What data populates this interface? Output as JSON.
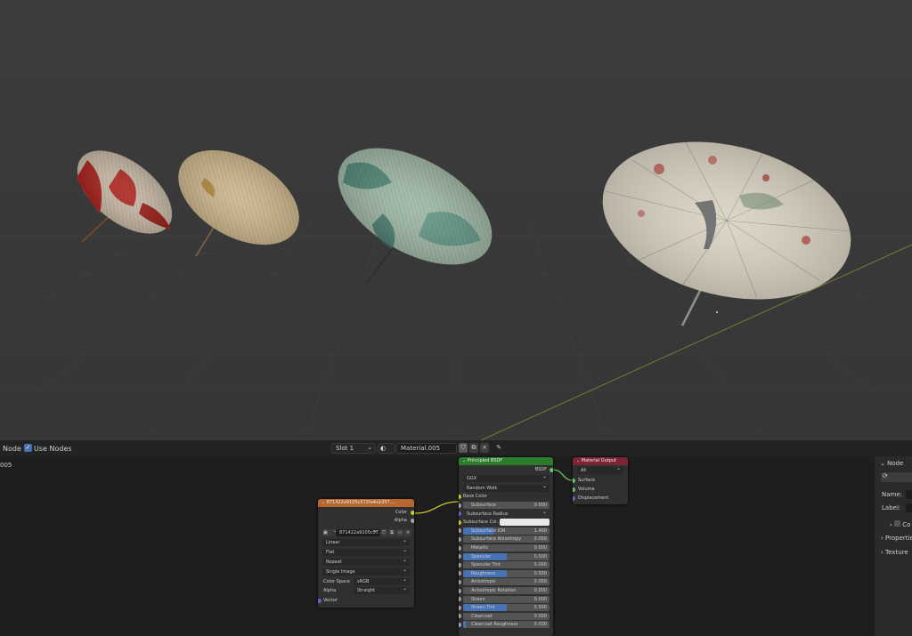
{
  "header": {
    "node_menu": "Node",
    "use_nodes_label": "Use Nodes",
    "slot": "Slot 1",
    "material_name": "Material.005",
    "left_fragment": "005"
  },
  "image_node": {
    "title": "871422a9105c572fa4a1057....",
    "image_name": "871422a9105c57...",
    "outputs": {
      "color": "Color",
      "alpha": "Alpha"
    },
    "interpolation": "Linear",
    "projection": "Flat",
    "extension": "Repeat",
    "source": "Single Image",
    "color_space_label": "Color Space",
    "color_space": "sRGB",
    "alpha_label": "Alpha",
    "alpha_mode": "Straight",
    "vector_label": "Vector"
  },
  "bsdf_node": {
    "title": "Principled BSDF",
    "output": "BSDF",
    "distribution": "GGX",
    "subsurface_method": "Random Walk",
    "base_color": "Base Color",
    "subsurface_radius": "Subsurface Radius",
    "subsurface_color": "Subsurface Col...",
    "fields": [
      {
        "label": "Subsurface",
        "value": "0.000",
        "fill": 0
      },
      {
        "label": "Subsurface IOR",
        "value": "1.400",
        "fill": 0.35
      },
      {
        "label": "Subsurface Anisotropy",
        "value": "0.000",
        "fill": 0
      },
      {
        "label": "Metallic",
        "value": "0.000",
        "fill": 0
      },
      {
        "label": "Specular",
        "value": "0.500",
        "fill": 0.5
      },
      {
        "label": "Specular Tint",
        "value": "0.000",
        "fill": 0
      },
      {
        "label": "Roughness",
        "value": "0.500",
        "fill": 0.5
      },
      {
        "label": "Anisotropic",
        "value": "0.000",
        "fill": 0
      },
      {
        "label": "Anisotropic Rotation",
        "value": "0.000",
        "fill": 0
      },
      {
        "label": "Sheen",
        "value": "0.000",
        "fill": 0
      },
      {
        "label": "Sheen Tint",
        "value": "0.500",
        "fill": 0.5
      },
      {
        "label": "Clearcoat",
        "value": "0.000",
        "fill": 0
      },
      {
        "label": "Clearcoat Roughness",
        "value": "0.030",
        "fill": 0.03
      }
    ]
  },
  "output_node": {
    "title": "Material Output",
    "target": "All",
    "inputs": [
      "Surface",
      "Volume",
      "Displacement"
    ]
  },
  "sidebar": {
    "node_panel": "Node",
    "name_label": "Name:",
    "label_label": "Label:",
    "co_fragment": "Co",
    "properties_fragment": "Propertie",
    "texture_fragment": "Texture"
  },
  "colors": {
    "image_header": "#b76630",
    "bsdf_header": "#2c7a2c",
    "output_header": "#7a2434",
    "accent": "#4772b3",
    "socket_color": "#c7c729",
    "socket_shader": "#63c763",
    "socket_float": "#a1a1a1",
    "socket_vector": "#6363c7"
  }
}
